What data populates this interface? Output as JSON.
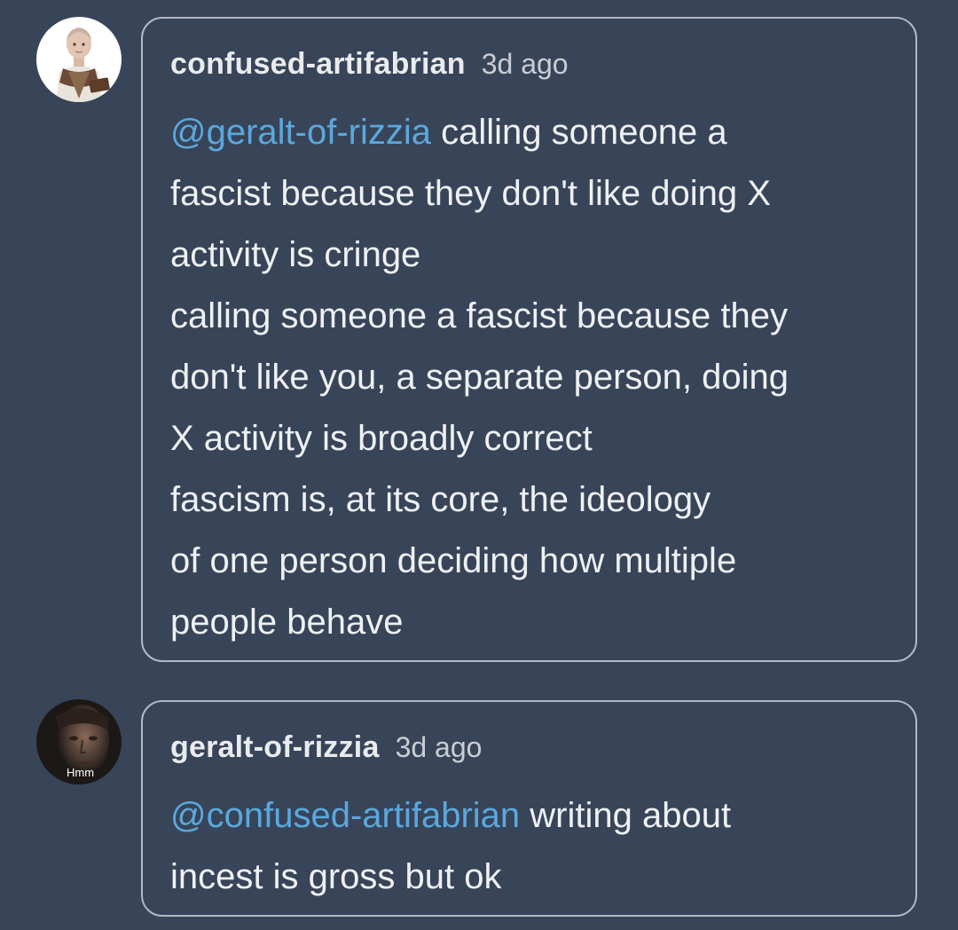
{
  "replies": [
    {
      "username": "confused-artifabrian",
      "timestamp": "3d ago",
      "avatar": "character-illustration-avatar",
      "avatar_caption": "",
      "mention": "@geralt-of-rizzia",
      "lines": [
        "calling someone a",
        "fascist because they don't like doing X",
        "activity is cringe",
        "calling someone a fascist because they",
        "don't like you, a separate person, doing",
        "X activity is broadly correct",
        "fascism is, at its core, the ideology",
        "of one person deciding how multiple",
        "people behave"
      ]
    },
    {
      "username": "geralt-of-rizzia",
      "timestamp": "3d ago",
      "avatar": "man-photo-avatar",
      "avatar_caption": "Hmm",
      "mention": "@confused-artifabrian",
      "lines": [
        "writing about",
        "incest is gross but ok"
      ]
    }
  ],
  "colors": {
    "background": "#384458",
    "mention": "#5aa8de",
    "bubble_border": "#b3b8c2"
  }
}
